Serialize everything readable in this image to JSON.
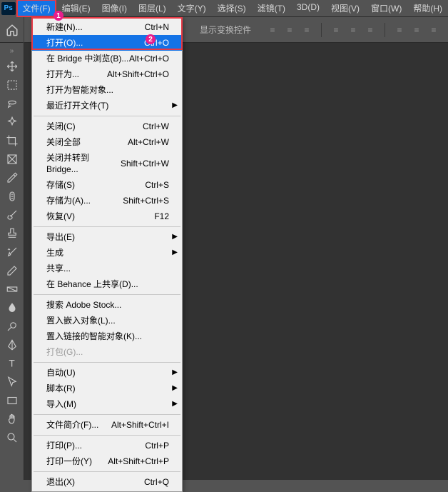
{
  "app": {
    "logo": "Ps"
  },
  "menubar": [
    "文件(F)",
    "编辑(E)",
    "图像(I)",
    "图层(L)",
    "文字(Y)",
    "选择(S)",
    "滤镜(T)",
    "3D(D)",
    "视图(V)",
    "窗口(W)",
    "帮助(H)"
  ],
  "toolbar": {
    "transform_controls": "显示变换控件"
  },
  "badges": {
    "one": "1",
    "two": "2"
  },
  "menu": {
    "new": {
      "label": "新建(N)...",
      "shortcut": "Ctrl+N"
    },
    "open": {
      "label": "打开(O)...",
      "shortcut": "Ctrl+O"
    },
    "browse_bridge": {
      "label": "在 Bridge 中浏览(B)...",
      "shortcut": "Alt+Ctrl+O"
    },
    "open_as": {
      "label": "打开为...",
      "shortcut": "Alt+Shift+Ctrl+O"
    },
    "open_smart": {
      "label": "打开为智能对象..."
    },
    "recent": {
      "label": "最近打开文件(T)"
    },
    "close": {
      "label": "关闭(C)",
      "shortcut": "Ctrl+W"
    },
    "close_all": {
      "label": "关闭全部",
      "shortcut": "Alt+Ctrl+W"
    },
    "close_bridge": {
      "label": "关闭并转到 Bridge...",
      "shortcut": "Shift+Ctrl+W"
    },
    "save": {
      "label": "存储(S)",
      "shortcut": "Ctrl+S"
    },
    "save_as": {
      "label": "存储为(A)...",
      "shortcut": "Shift+Ctrl+S"
    },
    "revert": {
      "label": "恢复(V)",
      "shortcut": "F12"
    },
    "export": {
      "label": "导出(E)"
    },
    "generate": {
      "label": "生成"
    },
    "share": {
      "label": "共享..."
    },
    "behance": {
      "label": "在 Behance 上共享(D)..."
    },
    "stock": {
      "label": "搜索 Adobe Stock..."
    },
    "place_embed": {
      "label": "置入嵌入对象(L)..."
    },
    "place_linked": {
      "label": "置入链接的智能对象(K)..."
    },
    "package": {
      "label": "打包(G)..."
    },
    "automate": {
      "label": "自动(U)"
    },
    "scripts": {
      "label": "脚本(R)"
    },
    "import": {
      "label": "导入(M)"
    },
    "file_info": {
      "label": "文件简介(F)...",
      "shortcut": "Alt+Shift+Ctrl+I"
    },
    "print": {
      "label": "打印(P)...",
      "shortcut": "Ctrl+P"
    },
    "print_one": {
      "label": "打印一份(Y)",
      "shortcut": "Alt+Shift+Ctrl+P"
    },
    "exit": {
      "label": "退出(X)",
      "shortcut": "Ctrl+Q"
    }
  }
}
